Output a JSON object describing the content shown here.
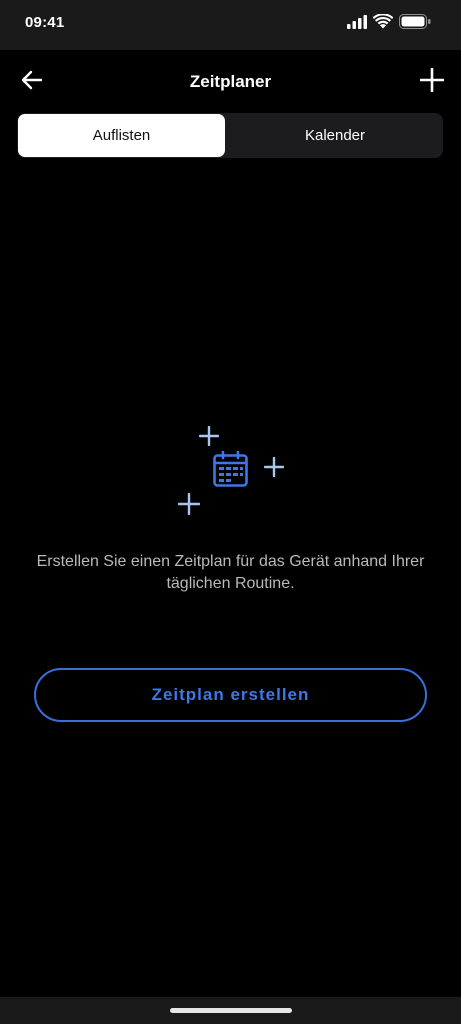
{
  "status_bar": {
    "time": "09:41",
    "icons": [
      "signal-icon",
      "wifi-icon",
      "battery-icon"
    ]
  },
  "header": {
    "title": "Zeitplaner",
    "back_icon": "arrow-left-icon",
    "add_icon": "plus-icon"
  },
  "tabs": [
    {
      "label": "Auflisten",
      "active": true
    },
    {
      "label": "Kalender",
      "active": false
    }
  ],
  "empty_state": {
    "illustration_icon": "calendar-icon",
    "message": "Erstellen Sie einen Zeitplan für das Gerät anhand Ihrer täglichen Routine.",
    "button_label": "Zeitplan erstellen"
  },
  "colors": {
    "background": "#000000",
    "accent": "#3d78e6",
    "sparkle": "#a9c6f2",
    "text_secondary": "#b9b9b9"
  }
}
